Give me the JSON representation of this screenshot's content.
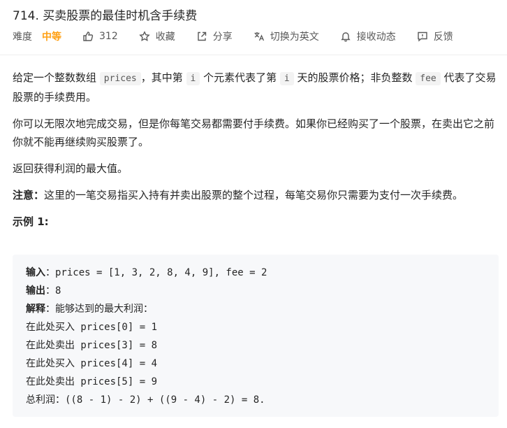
{
  "header": {
    "title": "714. 买卖股票的最佳时机含手续费",
    "difficulty_label": "难度",
    "difficulty_value": "中等",
    "likes": "312",
    "favorite": "收藏",
    "share": "分享",
    "switch_lang": "切换为英文",
    "notify": "接收动态",
    "feedback": "反馈"
  },
  "content": {
    "p1_a": "给定一个整数数组 ",
    "p1_code1": "prices",
    "p1_b": "，其中第 ",
    "p1_code2": "i",
    "p1_c": " 个元素代表了第 ",
    "p1_code3": "i",
    "p1_d": " 天的股票价格；非负整数 ",
    "p1_code4": "fee",
    "p1_e": " 代表了交易股票的手续费用。",
    "p2": "你可以无限次地完成交易，但是你每笔交易都需要付手续费。如果你已经购买了一个股票，在卖出它之前你就不能再继续购买股票了。",
    "p3": "返回获得利润的最大值。",
    "note_label": "注意：",
    "note_text": "这里的一笔交易指买入持有并卖出股票的整个过程，每笔交易你只需要为支付一次手续费。",
    "example_title": "示例 1:"
  },
  "example": {
    "input_label": "输入",
    "input_value": "：prices = [1, 3, 2, 8, 4, 9], fee = 2",
    "output_label": "输出",
    "output_value": "：8",
    "explain_label": "解释",
    "explain_value": "：能够达到的最大利润：",
    "lines": [
      "在此处买入 prices[0] = 1",
      "在此处卖出 prices[3] = 8",
      "在此处买入 prices[4] = 4",
      "在此处卖出 prices[5] = 9",
      "总利润：((8 - 1) - 2) + ((9 - 4) - 2) = 8."
    ]
  },
  "icons": [
    "thumbs-up-icon",
    "star-icon",
    "share-icon",
    "translate-icon",
    "bell-icon",
    "feedback-icon"
  ]
}
